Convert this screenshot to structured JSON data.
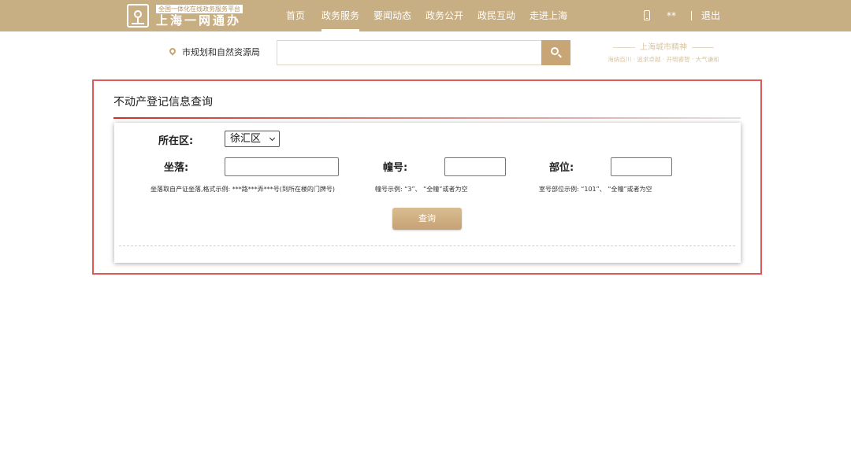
{
  "header": {
    "tagline": "全国一体化在线政务服务平台",
    "brand": "上海一网通办",
    "nav": [
      {
        "label": "首页",
        "active": false
      },
      {
        "label": "政务服务",
        "active": true
      },
      {
        "label": "要闻动态",
        "active": false
      },
      {
        "label": "政务公开",
        "active": false
      },
      {
        "label": "政民互动",
        "active": false
      },
      {
        "label": "走进上海",
        "active": false
      }
    ],
    "user": "**",
    "logout": "退出",
    "phone_icon": "mobile-phone-icon"
  },
  "search": {
    "department": "市规划和自然资源局",
    "placeholder": "",
    "location_icon": "map-pin-icon",
    "button_icon": "search-icon"
  },
  "spirit": {
    "title": "上海城市精神",
    "subtitle": "海纳百川 · 追求卓越 · 开明睿智 · 大气谦和"
  },
  "query": {
    "title": "不动产登记信息查询",
    "district_label": "所在区:",
    "district_value": "徐汇区",
    "location_label": "坐落:",
    "location_value": "",
    "location_hint": "坐落取自产证坐落,格式示例:  ***路***弄***号(到所在楼的门牌号)",
    "building_label": "幢号:",
    "building_value": "",
    "building_hint": "幢号示例:  “3”、 “全幢”或者为空",
    "unit_label": "部位:",
    "unit_value": "",
    "unit_hint": "室号部位示例:  “101”、 “全幢”或者为空",
    "submit_label": "查询"
  },
  "colors": {
    "header_bg": "#c8ae83",
    "accent": "#c8a574",
    "panel_border": "#e05a55",
    "title_rule": "#c9342f"
  }
}
